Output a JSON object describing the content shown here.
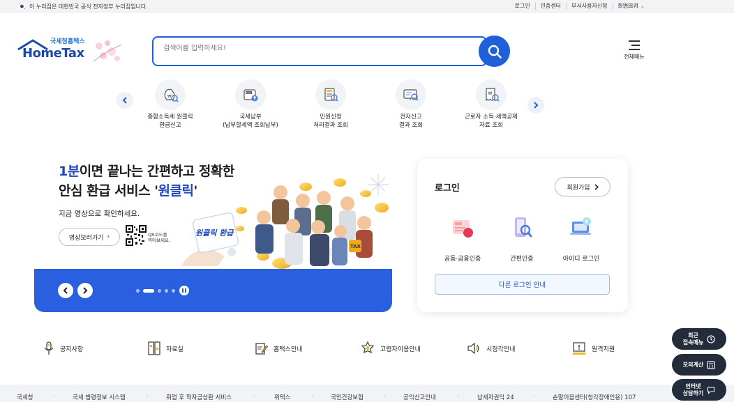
{
  "topbar": {
    "notice": "이 누리집은 대한민국 공식 전자정부 누리집입니다.",
    "links": [
      "로그인",
      "인증센터",
      "부서사용자신청",
      "화면크기"
    ],
    "zoom": "100%"
  },
  "header": {
    "logo_sub": "국세청홈택스",
    "logo_main": "HomeTax",
    "search_placeholder": "검색어를 입력하세요!",
    "allmenu_label": "전체메뉴"
  },
  "quick_services": [
    {
      "line1": "종합소득세 원클릭",
      "line2": "환급신고",
      "icon": "refund-search-icon"
    },
    {
      "line1": "국세납부",
      "line2": "(납부할세액 조회납부)",
      "icon": "tax-payment-icon"
    },
    {
      "line1": "민원신청",
      "line2": "처리결과 조회",
      "icon": "document-search-icon"
    },
    {
      "line1": "전자신고",
      "line2": "결과 조회",
      "icon": "monitor-search-icon"
    },
    {
      "line1": "근로자 소득·세액공제",
      "line2": "자료 조회",
      "icon": "receipt-search-icon"
    }
  ],
  "hero": {
    "title_line1_highlight": "1분",
    "title_line1_rest": "이면 끝나는 간편하고 정확한",
    "title_line2_a": "안심 환급 서비스 '",
    "title_line2_highlight": "원클릭",
    "title_line2_b": "'",
    "desc": "지금 영상으로 확인하세요.",
    "video_button": "영상보러가기",
    "qr_text_1": "QR코드를",
    "qr_text_2": "찍어보세요.",
    "art_label": "원클릭 환급",
    "art_tax_label": "TAX"
  },
  "login": {
    "title": "로그인",
    "join_button": "회원가입",
    "methods": [
      "공동·금융인증",
      "간편인증",
      "아이디 로그인"
    ],
    "other_login": "다른 로그인 안내"
  },
  "quick_links": [
    "공지사항",
    "자료실",
    "홈택스안내",
    "고령자이용안내",
    "시청각안내",
    "원격지원"
  ],
  "footer": [
    "국세청",
    "국세 법령정보 시스템",
    "취업 후 학자금상환 서비스",
    "위택스",
    "국민건강보험",
    "공익신고안내",
    "납세자권익 24",
    "손말이음센터(청각장애인용) 107"
  ],
  "floating": {
    "recent_1": "최근",
    "recent_2": "접속메뉴",
    "calc": "모의계산",
    "chat_1": "인터넷",
    "chat_2": "상담하기"
  },
  "colors": {
    "primary": "#1f5fd8",
    "banner": "#2a5fe0",
    "dark_float": "#232c3b"
  }
}
